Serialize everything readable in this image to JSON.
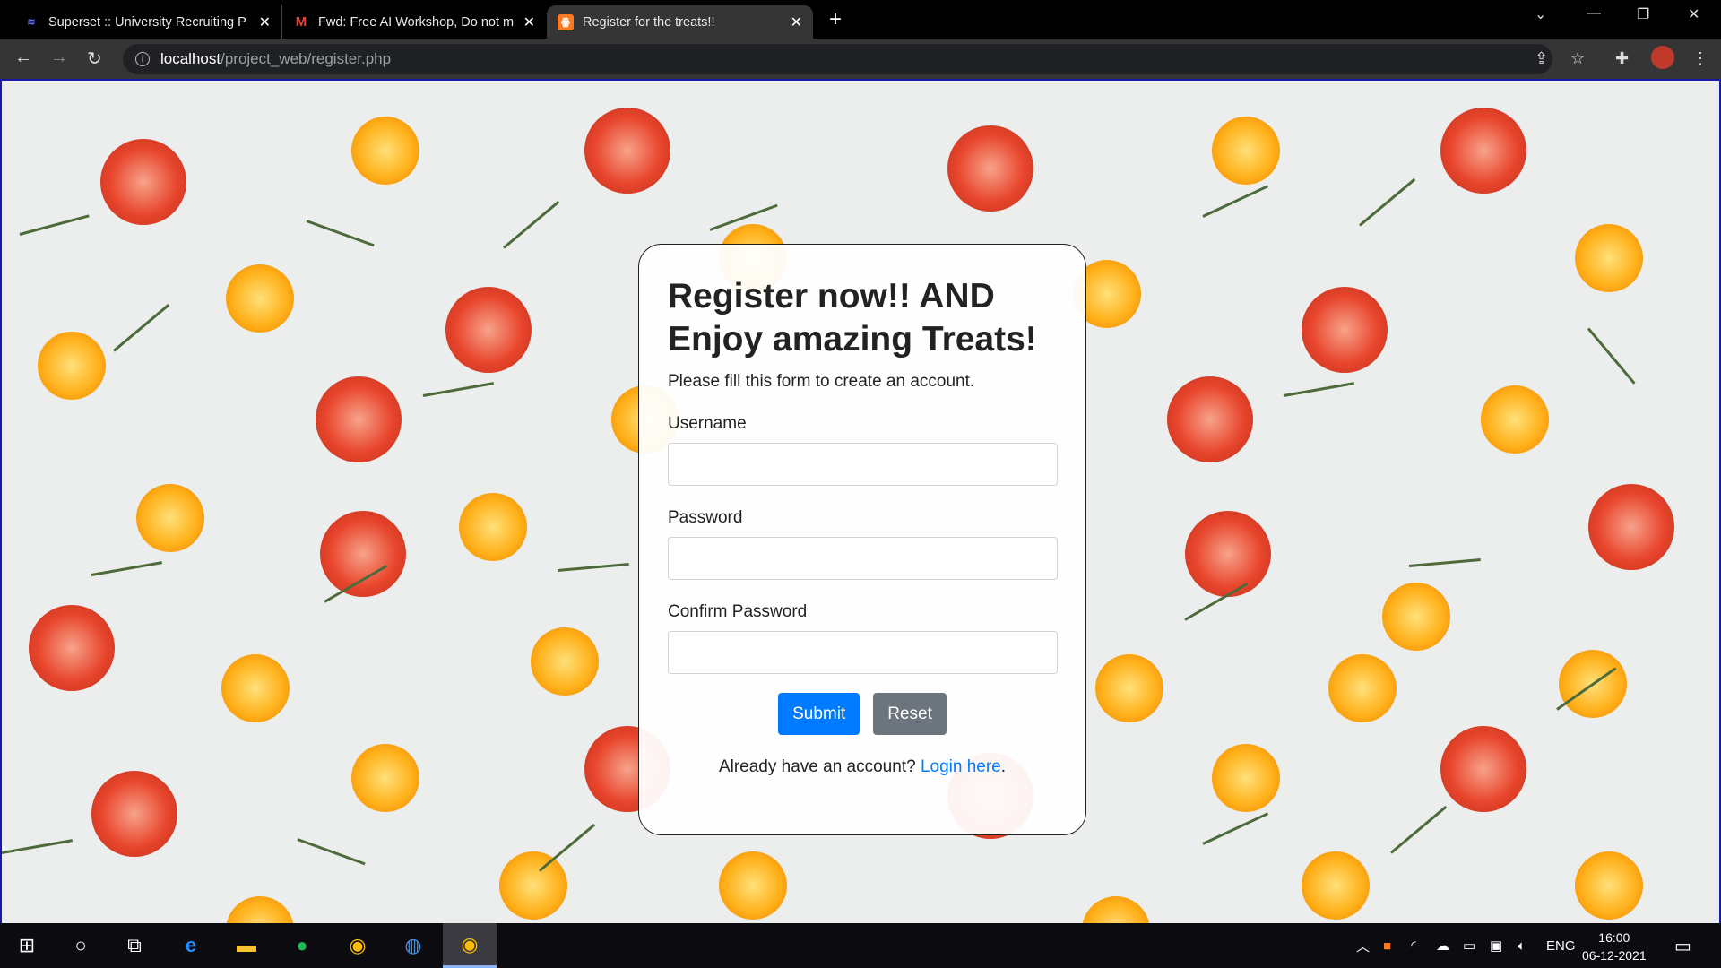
{
  "browser": {
    "tabs": [
      {
        "title": "Superset :: University Recruiting P",
        "icon": "superset-icon"
      },
      {
        "title": "Fwd: Free AI Workshop, Do not m",
        "icon": "gmail-icon"
      },
      {
        "title": "Register for the treats!!",
        "icon": "xampp-icon",
        "active": true
      }
    ],
    "url_host": "localhost",
    "url_path": "/project_web/register.php"
  },
  "form": {
    "title": "Register now!! AND Enjoy amazing Treats!",
    "subtitle": "Please fill this form to create an account.",
    "username_label": "Username",
    "password_label": "Password",
    "confirm_label": "Confirm Password",
    "username_value": "",
    "password_value": "",
    "confirm_value": "",
    "submit": "Submit",
    "reset": "Reset",
    "login_prompt": "Already have an account?",
    "login_link": "Login here",
    "login_suffix": "."
  },
  "taskbar": {
    "language": "ENG",
    "time": "16:00",
    "date": "06-12-2021"
  },
  "colors": {
    "primary": "#007bff",
    "secondary": "#6c757d"
  }
}
